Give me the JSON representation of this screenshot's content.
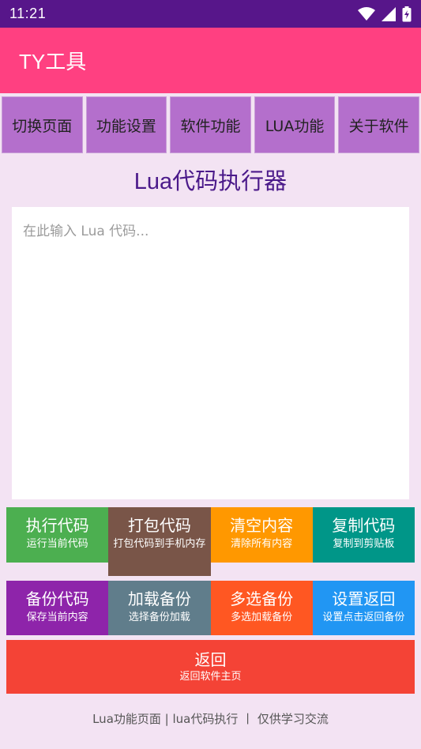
{
  "status_bar": {
    "time": "11:21"
  },
  "app": {
    "title": "TY工具"
  },
  "tabs": [
    {
      "label": "切换页面"
    },
    {
      "label": "功能设置"
    },
    {
      "label": "软件功能"
    },
    {
      "label": "LUA功能"
    },
    {
      "label": "关于软件"
    }
  ],
  "page": {
    "title": "Lua代码执行器"
  },
  "editor": {
    "placeholder": "在此输入 Lua 代码..."
  },
  "buttons_row1": [
    {
      "label": "执行代码",
      "sub": "运行当前代码",
      "color": "#4caf50"
    },
    {
      "label": "打包代码",
      "sub": "打包代码到手机内存",
      "color": "#795548"
    },
    {
      "label": "清空内容",
      "sub": "清除所有内容",
      "color": "#ff9800"
    },
    {
      "label": "复制代码",
      "sub": "复制到剪贴板",
      "color": "#009688"
    }
  ],
  "buttons_row2": [
    {
      "label": "备份代码",
      "sub": "保存当前内容",
      "color": "#8e24aa"
    },
    {
      "label": "加载备份",
      "sub": "选择备份加载",
      "color": "#607d8b"
    },
    {
      "label": "多选备份",
      "sub": "多选加载备份",
      "color": "#ff5722"
    },
    {
      "label": "设置返回",
      "sub": "设置点击返回备份",
      "color": "#2196f3"
    }
  ],
  "back_button": {
    "label": "返回",
    "sub": "返回软件主页",
    "color": "#f44336"
  },
  "footer": {
    "text": "Lua功能页面 | lua代码执行 丨 仅供学习交流"
  }
}
